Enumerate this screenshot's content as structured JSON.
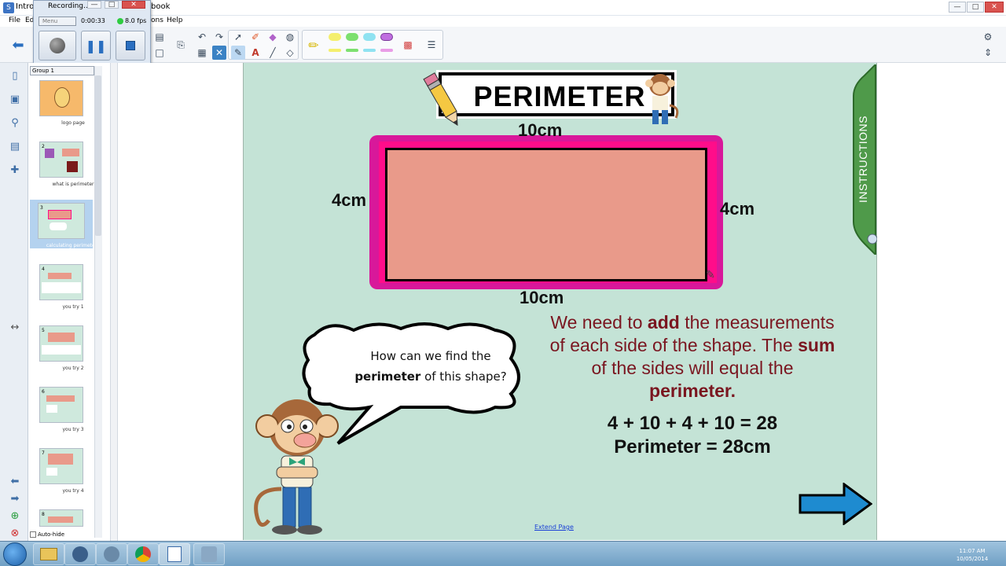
{
  "window": {
    "title_left": "Introd",
    "title_right": "book",
    "min_label": "—",
    "max_label": "□",
    "close_label": "✕"
  },
  "menu": {
    "file": "File",
    "edit": "Edi",
    "ons": "ons",
    "help": "Help"
  },
  "recorder": {
    "title": "Recording...",
    "menu_label": "Menu",
    "time": "0:00:33",
    "fps": "8.0 fps"
  },
  "sorter": {
    "group": "Group 1",
    "pages": [
      {
        "num": "",
        "label": "logo page"
      },
      {
        "num": "2",
        "label": "what is perimeter"
      },
      {
        "num": "3",
        "label": "calculating perimeter"
      },
      {
        "num": "4",
        "label": "you try 1"
      },
      {
        "num": "5",
        "label": "you try 2"
      },
      {
        "num": "6",
        "label": "you try 3"
      },
      {
        "num": "7",
        "label": "you try 4"
      },
      {
        "num": "8",
        "label": ""
      }
    ],
    "autohide": "Auto-hide"
  },
  "slide": {
    "title": "PERIMETER",
    "dims": {
      "top": "10cm",
      "bottom": "10cm",
      "left": "4cm",
      "right": "4cm"
    },
    "bubble_line1": "How can we find the",
    "bubble_bold": "perimeter",
    "bubble_line2_rest": " of this shape?",
    "explain_1": "We need to ",
    "explain_add": "add",
    "explain_2": " the measurements of each side of the shape. The ",
    "explain_sum": "sum",
    "explain_3": " of the sides will equal the ",
    "explain_perimeter": "perimeter.",
    "equation": "4 + 10 + 4 + 10 = 28",
    "result": "Perimeter = 28cm",
    "extend": "Extend Page",
    "instructions": "INSTRUCTIONS"
  },
  "tray": {
    "time": "11:07 AM",
    "date": "10/05/2014"
  },
  "colors": {
    "slide_bg": "#c4e3d6",
    "rect_fill": "#e99a8a",
    "rect_border_pink": "#ff0d8a",
    "rect_border_purple": "#d8189a",
    "explain_text": "#7a1620",
    "arrow": "#1e8bd0"
  }
}
